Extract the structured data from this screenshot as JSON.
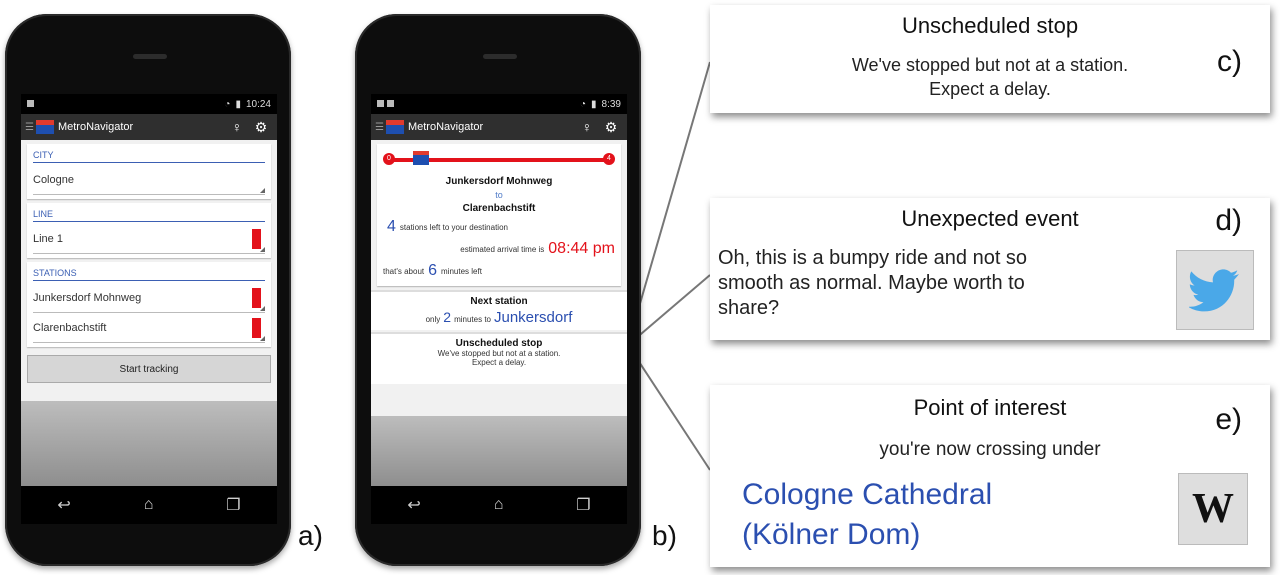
{
  "phone_a": {
    "status_time": "10:24",
    "app_title": "MetroNavigator",
    "city": {
      "header": "CITY",
      "value": "Cologne"
    },
    "line": {
      "header": "LINE",
      "value": "Line 1"
    },
    "stations": {
      "header": "STATIONS",
      "from": "Junkersdorf Mohnweg",
      "to": "Clarenbachstift"
    },
    "start_button": "Start tracking",
    "label": "a)"
  },
  "phone_b": {
    "status_time": "8:39",
    "app_title": "MetroNavigator",
    "rail_start": "0",
    "rail_end": "4",
    "from_station": "Junkersdorf Mohnweg",
    "to_word": "to",
    "to_station": "Clarenbachstift",
    "stations_left_num": "4",
    "stations_left_text": "stations left to your destination",
    "arrival_text": "estimated arrival time is",
    "arrival_time": "08:44 pm",
    "about_prefix": "that's about",
    "about_num": "6",
    "about_suffix": "minutes left",
    "next_header": "Next station",
    "next_only": "only",
    "next_num": "2",
    "next_minutes": "minutes to",
    "next_dest": "Junkersdorf",
    "unscheduled_header": "Unscheduled stop",
    "unscheduled_line1": "We've stopped but not at a station.",
    "unscheduled_line2": "Expect a delay.",
    "label": "b)"
  },
  "callout_c": {
    "title": "Unscheduled stop",
    "line1": "We've stopped but not at a station.",
    "line2": "Expect a delay.",
    "label": "c)"
  },
  "callout_d": {
    "title": "Unexpected event",
    "line1": "Oh, this is a bumpy ride and not so",
    "line2": "smooth as normal. Maybe worth to",
    "line3": "share?",
    "label": "d)"
  },
  "callout_e": {
    "title": "Point of interest",
    "subtitle": "you're now crossing under",
    "poi_line1": "Cologne Cathedral",
    "poi_line2": "(Kölner Dom)",
    "wiki_glyph": "W",
    "label": "e)"
  },
  "colors": {
    "accent_blue": "#2b4fb0",
    "alert_red": "#e3121b"
  }
}
